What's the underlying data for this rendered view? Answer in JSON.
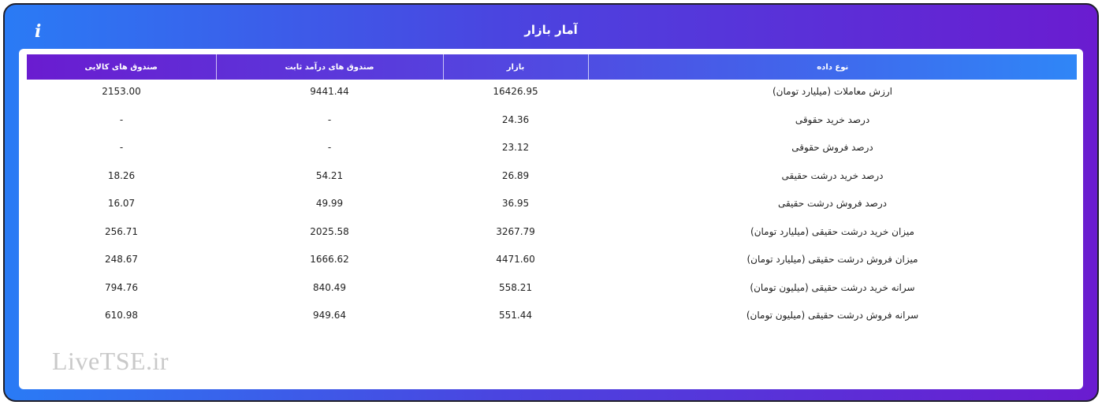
{
  "header": {
    "title": "آمار بازار",
    "info_icon": "i"
  },
  "table": {
    "columns": [
      "نوع داده",
      "بازار",
      "صندوق های درآمد ثابت",
      "صندوق های کالایی"
    ],
    "rows": [
      [
        "ارزش معاملات (میلیارد تومان)",
        "16426.95",
        "9441.44",
        "2153.00"
      ],
      [
        "درصد خرید حقوقی",
        "24.36",
        "-",
        "-"
      ],
      [
        "درصد فروش حقوقی",
        "23.12",
        "-",
        "-"
      ],
      [
        "درصد خرید درشت حقیقی",
        "26.89",
        "54.21",
        "18.26"
      ],
      [
        "درصد فروش درشت حقیقی",
        "36.95",
        "49.99",
        "16.07"
      ],
      [
        "میزان خرید درشت حقیقی (میلیارد تومان)",
        "3267.79",
        "2025.58",
        "256.71"
      ],
      [
        "میزان فروش درشت حقیقی (میلیارد تومان)",
        "4471.60",
        "1666.62",
        "248.67"
      ],
      [
        "سرانه خرید درشت حقیقی (میلیون تومان)",
        "558.21",
        "840.49",
        "794.76"
      ],
      [
        "سرانه فروش درشت حقیقی (میلیون تومان)",
        "551.44",
        "949.64",
        "610.98"
      ]
    ]
  },
  "watermark": "LiveTSE.ir",
  "colors": {
    "gradient_start": "#2a7bf5",
    "gradient_end": "#6a1cd0"
  }
}
